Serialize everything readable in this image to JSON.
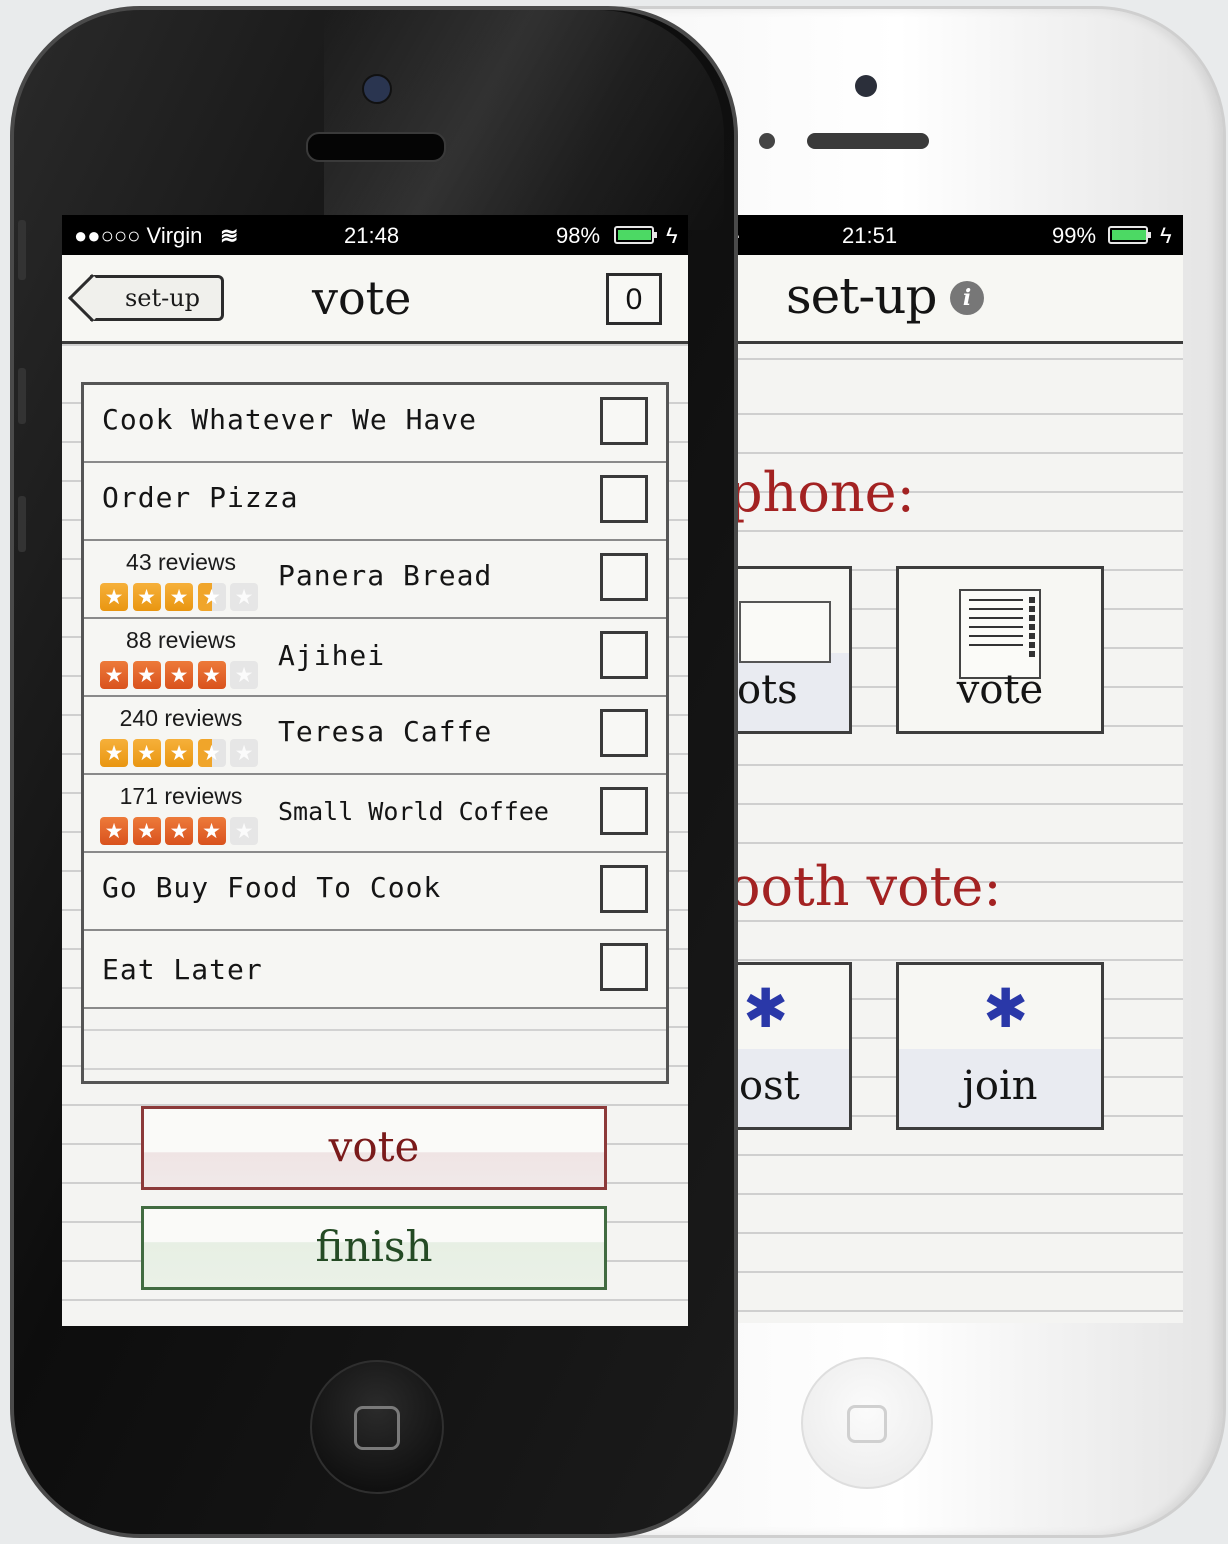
{
  "back_phone": {
    "status": {
      "time": "21:51",
      "battery": "99%",
      "battery_level": 0.99
    },
    "header": {
      "title": "set-up",
      "info_glyph": "i"
    },
    "sections": [
      {
        "label": "phone:",
        "tiles": [
          "ots",
          "vote"
        ]
      },
      {
        "label": "ooth  vote:",
        "tiles": [
          "ost",
          "join"
        ]
      }
    ],
    "icons": {
      "bluetooth": "✱"
    }
  },
  "front_phone": {
    "status": {
      "carrier": "●●○○○ Virgin",
      "wifi": "≋",
      "time": "21:48",
      "battery": "98%",
      "battery_level": 0.98,
      "charging": "ϟ"
    },
    "header": {
      "back_label": "set-up",
      "title": "vote",
      "vote_count": "0"
    },
    "rows": [
      {
        "name": "Cook Whatever We Have"
      },
      {
        "name": "Order Pizza"
      },
      {
        "name": "Panera Bread",
        "reviews": "43 reviews",
        "stars": "★★★★☆",
        "rating": 3.5
      },
      {
        "name": "Ajihei",
        "reviews": "88 reviews",
        "stars": "★★★★☆",
        "rating": 4
      },
      {
        "name": "Teresa Caffe",
        "reviews": "240 reviews",
        "stars": "★★★★☆",
        "rating": 3.5
      },
      {
        "name": "Small World Coffee",
        "reviews": "171 reviews",
        "stars": "★★★★☆",
        "rating": 4
      },
      {
        "name": "Go Buy Food To Cook"
      },
      {
        "name": "Eat Later"
      }
    ],
    "buttons": {
      "vote": "vote",
      "finish": "finish"
    }
  },
  "colors": {
    "accent_red": "#a32222",
    "finish_green": "#244a24",
    "battery_green": "#4cd964",
    "star_orange": "#f0a52a",
    "star_red": "#d9521d"
  }
}
